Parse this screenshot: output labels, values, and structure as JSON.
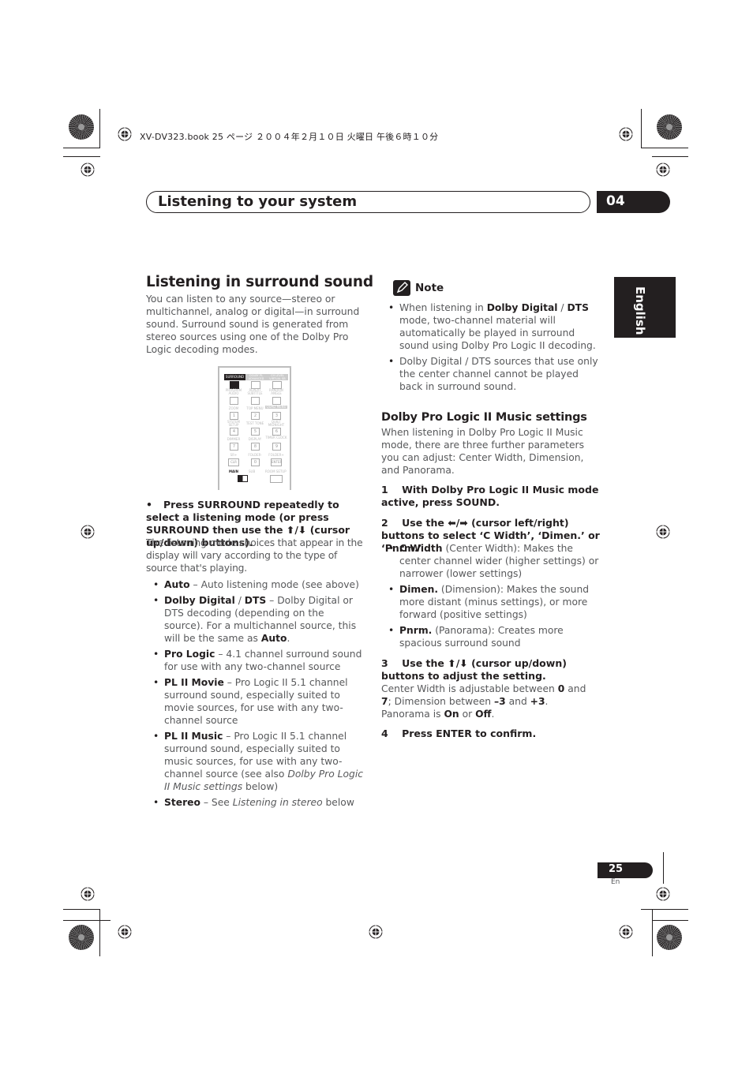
{
  "print_header": {
    "book_line": "XV-DV323.book  25 ページ  ２００４年２月１０日  火曜日  午後６時１０分"
  },
  "chapter": {
    "title": "Listening to your system",
    "number": "04"
  },
  "language_tab": "English",
  "left_column": {
    "heading": "Listening in surround sound",
    "intro": "You can listen to any source—stereo or multichannel, analog or digital—in surround sound. Surround sound is generated from stereo sources using one of the Dolby Pro Logic decoding modes.",
    "remote": {
      "top_labels": [
        "SURROUND",
        "DOLBY PL ADVANCED",
        "CH LEVEL VIRTUAL SB"
      ],
      "rows": [
        {
          "labels": [
            "PROGRAM AUDIO",
            "REPEAT SUBTITLE",
            "RANDOM ANGLE"
          ],
          "keys": [
            "",
            "",
            ""
          ]
        },
        {
          "labels": [
            "ZOOM",
            "TOP MENU",
            "QUAD MENU"
          ],
          "keys": [
            "1",
            "2",
            "3"
          ]
        },
        {
          "labels": [
            "SYSTEM SETUP",
            "TEST TONE",
            "QUIET MIDNIGHT"
          ],
          "keys": [
            "4",
            "5",
            "6"
          ]
        },
        {
          "labels": [
            "DIMMER",
            "DISPLAY",
            "TIMER CLOCK"
          ],
          "keys": [
            "7",
            "8",
            "9"
          ]
        },
        {
          "labels": [
            "SR+",
            "FOLDER-",
            "FOLDER+"
          ],
          "keys": [
            "CLR",
            "0",
            "ENTER"
          ]
        }
      ],
      "switch_main": "MAIN",
      "switch_sub": "SUB",
      "room_setup": "ROOM SETUP"
    },
    "step": {
      "bullet": "•",
      "instruction": "Press SURROUND repeatedly to select a listening mode (or press SURROUND then use the ⬆/⬇ (cursor up/down) buttons).",
      "description": "The listening mode choices that appear in the display will vary according to the type of source that's playing."
    },
    "modes": [
      {
        "name": "Auto",
        "text": " – Auto listening mode (see above)"
      },
      {
        "name": "Dolby Digital",
        "sep": " / ",
        "name2": "DTS",
        "text": " – Dolby Digital or DTS decoding (depending on the source). For a multichannel source, this will be the same as ",
        "tail_bold": "Auto",
        "tail": "."
      },
      {
        "name": "Pro Logic",
        "text": " – 4.1 channel surround sound for use with any two-channel source"
      },
      {
        "name": "PL II Movie",
        "text": " – Pro Logic II 5.1 channel surround sound, especially suited to movie sources, for use with any two-channel source"
      },
      {
        "name": "PL II Music",
        "text": " – Pro Logic II 5.1 channel surround sound, especially suited to music sources, for use with any two-channel source (see also ",
        "italic": "Dolby Pro Logic II Music settings",
        "tail": " below)"
      },
      {
        "name": "Stereo",
        "text": " – See ",
        "italic": "Listening in stereo",
        "tail": " below"
      }
    ]
  },
  "right_column": {
    "note": {
      "label": "Note",
      "items": [
        {
          "pre": "When listening in ",
          "b1": "Dolby Digital",
          "mid": " / ",
          "b2": "DTS",
          "post": " mode, two-channel material will automatically be played in surround sound using Dolby Pro Logic II decoding."
        },
        {
          "text": "Dolby Digital / DTS sources that use only the center channel cannot be played back in surround sound."
        }
      ]
    },
    "subheading": "Dolby Pro Logic II Music settings",
    "intro": "When listening in Dolby Pro Logic II Music mode, there are three further parameters you can adjust: Center Width, Dimension, and Panorama.",
    "step1": "1    With Dolby Pro Logic II Music mode active, press SOUND.",
    "step2": "2    Use the ⬅/➡ (cursor left/right) buttons to select ‘C Width’, ‘Dimen.’ or ‘Pnrm.’",
    "params": [
      {
        "name": "C Width",
        "text": " (Center Width): Makes the center channel wider (higher settings) or narrower (lower settings)"
      },
      {
        "name": "Dimen.",
        "text": " (Dimension): Makes the sound more distant (minus settings), or more forward (positive settings)"
      },
      {
        "name": "Pnrm.",
        "text": " (Panorama): Creates more spacious surround sound"
      }
    ],
    "step3": "3    Use the ⬆/⬇ (cursor up/down) buttons to adjust the setting.",
    "step3_detail": {
      "t1": "Center Width is adjustable between ",
      "v1": "0",
      "t2": " and ",
      "v2": "7",
      "t3": "; Dimension between ",
      "v3": "–3",
      "t4": " and ",
      "v4": "+3",
      "t5": ". Panorama is ",
      "v5": "On",
      "t6": " or ",
      "v6": "Off",
      "t7": "."
    },
    "step4": "4    Press ENTER to confirm."
  },
  "footer": {
    "page_number": "25",
    "lang_code": "En"
  }
}
